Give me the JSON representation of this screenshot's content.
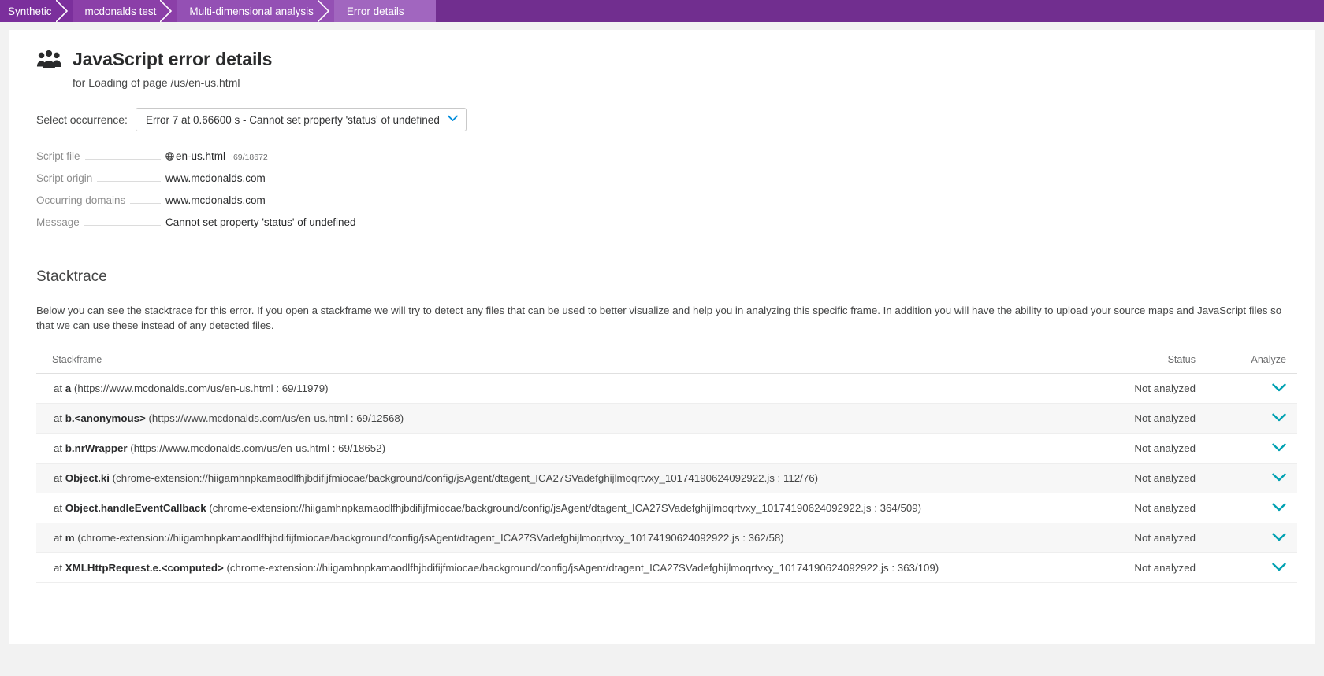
{
  "breadcrumb": {
    "items": [
      {
        "label": "Synthetic"
      },
      {
        "label": "mcdonalds test"
      },
      {
        "label": "Multi-dimensional analysis"
      },
      {
        "label": "Error details"
      }
    ]
  },
  "header": {
    "icon": "people-icon",
    "title": "JavaScript error details",
    "subtitle": "for Loading of page /us/en-us.html"
  },
  "occurrence": {
    "label": "Select occurrence:",
    "selected": "Error 7 at 0.66600 s - Cannot set property 'status' of undefined",
    "caret_icon": "chevron-down-icon"
  },
  "properties": [
    {
      "label": "Script file",
      "value": "en-us.html",
      "icon": "globe-icon",
      "line_ref": ":69/18672"
    },
    {
      "label": "Script origin",
      "value": "www.mcdonalds.com",
      "icon": "",
      "line_ref": ""
    },
    {
      "label": "Occurring domains",
      "value": "www.mcdonalds.com",
      "icon": "",
      "line_ref": ""
    },
    {
      "label": "Message",
      "value": "Cannot set property 'status' of undefined",
      "icon": "",
      "line_ref": ""
    }
  ],
  "stacktrace": {
    "title": "Stacktrace",
    "description": "Below you can see the stacktrace for this error. If you open a stackframe we will try to detect any files that can be used to better visualize and help you in analyzing this specific frame. In addition you will have the ability to upload your source maps and JavaScript files so that we can use these instead of any detected files.",
    "columns": {
      "frame": "Stackframe",
      "status": "Status",
      "analyze": "Analyze"
    },
    "rows": [
      {
        "prefix": "at ",
        "fn": "a",
        "location": " (https://www.mcdonalds.com/us/en-us.html : 69/11979)",
        "status": "Not analyzed",
        "analyze_icon": "chevron-down-icon"
      },
      {
        "prefix": "at ",
        "fn": "b.<anonymous>",
        "location": " (https://www.mcdonalds.com/us/en-us.html : 69/12568)",
        "status": "Not analyzed",
        "analyze_icon": "chevron-down-icon"
      },
      {
        "prefix": "at ",
        "fn": "b.nrWrapper",
        "location": " (https://www.mcdonalds.com/us/en-us.html : 69/18652)",
        "status": "Not analyzed",
        "analyze_icon": "chevron-down-icon"
      },
      {
        "prefix": "at ",
        "fn": "Object.ki",
        "location": " (chrome-extension://hiigamhnpkamaodlfhjbdifijfmiocae/background/config/jsAgent/dtagent_ICA27SVadefghijlmoqrtvxy_10174190624092922.js : 112/76)",
        "status": "Not analyzed",
        "analyze_icon": "chevron-down-icon"
      },
      {
        "prefix": "at ",
        "fn": "Object.handleEventCallback",
        "location": " (chrome-extension://hiigamhnpkamaodlfhjbdifijfmiocae/background/config/jsAgent/dtagent_ICA27SVadefghijlmoqrtvxy_10174190624092922.js : 364/509)",
        "status": "Not analyzed",
        "analyze_icon": "chevron-down-icon"
      },
      {
        "prefix": "at ",
        "fn": "m",
        "location": " (chrome-extension://hiigamhnpkamaodlfhjbdifijfmiocae/background/config/jsAgent/dtagent_ICA27SVadefghijlmoqrtvxy_10174190624092922.js : 362/58)",
        "status": "Not analyzed",
        "analyze_icon": "chevron-down-icon"
      },
      {
        "prefix": "at ",
        "fn": "XMLHttpRequest.e.<computed>",
        "location": " (chrome-extension://hiigamhnpkamaodlfhjbdifijfmiocae/background/config/jsAgent/dtagent_ICA27SVadefghijlmoqrtvxy_10174190624092922.js : 363/109)",
        "status": "Not analyzed",
        "analyze_icon": "chevron-down-icon"
      }
    ]
  },
  "colors": {
    "breadcrumb_bg": "#712e8f",
    "accent_teal": "#00a1b2",
    "accent_blue": "#008cdb",
    "text": "#454646",
    "muted": "#8d8d8d"
  }
}
